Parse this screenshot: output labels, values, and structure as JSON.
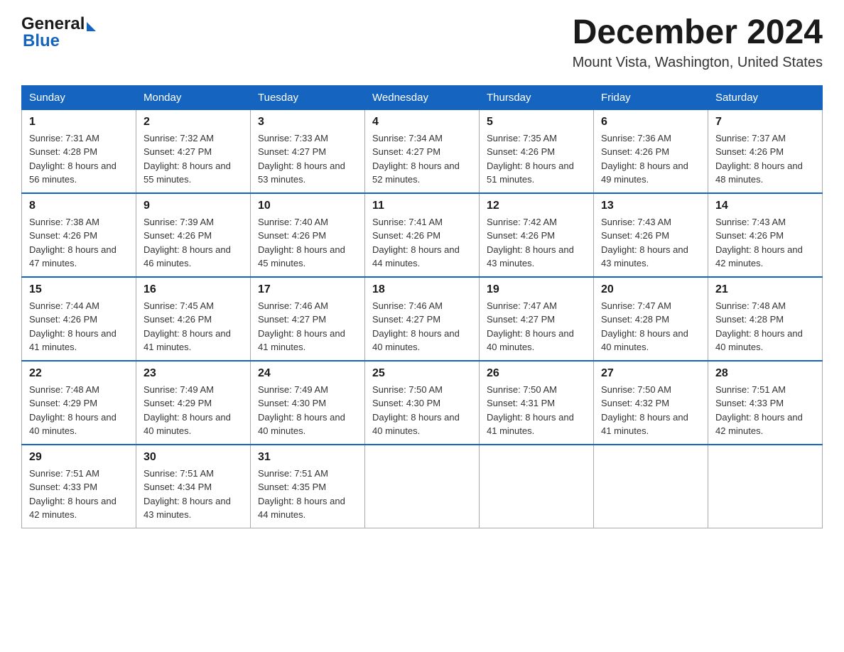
{
  "header": {
    "logo_general": "General",
    "logo_blue": "Blue",
    "month_title": "December 2024",
    "location": "Mount Vista, Washington, United States"
  },
  "calendar": {
    "days_of_week": [
      "Sunday",
      "Monday",
      "Tuesday",
      "Wednesday",
      "Thursday",
      "Friday",
      "Saturday"
    ],
    "weeks": [
      [
        {
          "day": "1",
          "sunrise": "7:31 AM",
          "sunset": "4:28 PM",
          "daylight": "8 hours and 56 minutes."
        },
        {
          "day": "2",
          "sunrise": "7:32 AM",
          "sunset": "4:27 PM",
          "daylight": "8 hours and 55 minutes."
        },
        {
          "day": "3",
          "sunrise": "7:33 AM",
          "sunset": "4:27 PM",
          "daylight": "8 hours and 53 minutes."
        },
        {
          "day": "4",
          "sunrise": "7:34 AM",
          "sunset": "4:27 PM",
          "daylight": "8 hours and 52 minutes."
        },
        {
          "day": "5",
          "sunrise": "7:35 AM",
          "sunset": "4:26 PM",
          "daylight": "8 hours and 51 minutes."
        },
        {
          "day": "6",
          "sunrise": "7:36 AM",
          "sunset": "4:26 PM",
          "daylight": "8 hours and 49 minutes."
        },
        {
          "day": "7",
          "sunrise": "7:37 AM",
          "sunset": "4:26 PM",
          "daylight": "8 hours and 48 minutes."
        }
      ],
      [
        {
          "day": "8",
          "sunrise": "7:38 AM",
          "sunset": "4:26 PM",
          "daylight": "8 hours and 47 minutes."
        },
        {
          "day": "9",
          "sunrise": "7:39 AM",
          "sunset": "4:26 PM",
          "daylight": "8 hours and 46 minutes."
        },
        {
          "day": "10",
          "sunrise": "7:40 AM",
          "sunset": "4:26 PM",
          "daylight": "8 hours and 45 minutes."
        },
        {
          "day": "11",
          "sunrise": "7:41 AM",
          "sunset": "4:26 PM",
          "daylight": "8 hours and 44 minutes."
        },
        {
          "day": "12",
          "sunrise": "7:42 AM",
          "sunset": "4:26 PM",
          "daylight": "8 hours and 43 minutes."
        },
        {
          "day": "13",
          "sunrise": "7:43 AM",
          "sunset": "4:26 PM",
          "daylight": "8 hours and 43 minutes."
        },
        {
          "day": "14",
          "sunrise": "7:43 AM",
          "sunset": "4:26 PM",
          "daylight": "8 hours and 42 minutes."
        }
      ],
      [
        {
          "day": "15",
          "sunrise": "7:44 AM",
          "sunset": "4:26 PM",
          "daylight": "8 hours and 41 minutes."
        },
        {
          "day": "16",
          "sunrise": "7:45 AM",
          "sunset": "4:26 PM",
          "daylight": "8 hours and 41 minutes."
        },
        {
          "day": "17",
          "sunrise": "7:46 AM",
          "sunset": "4:27 PM",
          "daylight": "8 hours and 41 minutes."
        },
        {
          "day": "18",
          "sunrise": "7:46 AM",
          "sunset": "4:27 PM",
          "daylight": "8 hours and 40 minutes."
        },
        {
          "day": "19",
          "sunrise": "7:47 AM",
          "sunset": "4:27 PM",
          "daylight": "8 hours and 40 minutes."
        },
        {
          "day": "20",
          "sunrise": "7:47 AM",
          "sunset": "4:28 PM",
          "daylight": "8 hours and 40 minutes."
        },
        {
          "day": "21",
          "sunrise": "7:48 AM",
          "sunset": "4:28 PM",
          "daylight": "8 hours and 40 minutes."
        }
      ],
      [
        {
          "day": "22",
          "sunrise": "7:48 AM",
          "sunset": "4:29 PM",
          "daylight": "8 hours and 40 minutes."
        },
        {
          "day": "23",
          "sunrise": "7:49 AM",
          "sunset": "4:29 PM",
          "daylight": "8 hours and 40 minutes."
        },
        {
          "day": "24",
          "sunrise": "7:49 AM",
          "sunset": "4:30 PM",
          "daylight": "8 hours and 40 minutes."
        },
        {
          "day": "25",
          "sunrise": "7:50 AM",
          "sunset": "4:30 PM",
          "daylight": "8 hours and 40 minutes."
        },
        {
          "day": "26",
          "sunrise": "7:50 AM",
          "sunset": "4:31 PM",
          "daylight": "8 hours and 41 minutes."
        },
        {
          "day": "27",
          "sunrise": "7:50 AM",
          "sunset": "4:32 PM",
          "daylight": "8 hours and 41 minutes."
        },
        {
          "day": "28",
          "sunrise": "7:51 AM",
          "sunset": "4:33 PM",
          "daylight": "8 hours and 42 minutes."
        }
      ],
      [
        {
          "day": "29",
          "sunrise": "7:51 AM",
          "sunset": "4:33 PM",
          "daylight": "8 hours and 42 minutes."
        },
        {
          "day": "30",
          "sunrise": "7:51 AM",
          "sunset": "4:34 PM",
          "daylight": "8 hours and 43 minutes."
        },
        {
          "day": "31",
          "sunrise": "7:51 AM",
          "sunset": "4:35 PM",
          "daylight": "8 hours and 44 minutes."
        },
        null,
        null,
        null,
        null
      ]
    ]
  }
}
